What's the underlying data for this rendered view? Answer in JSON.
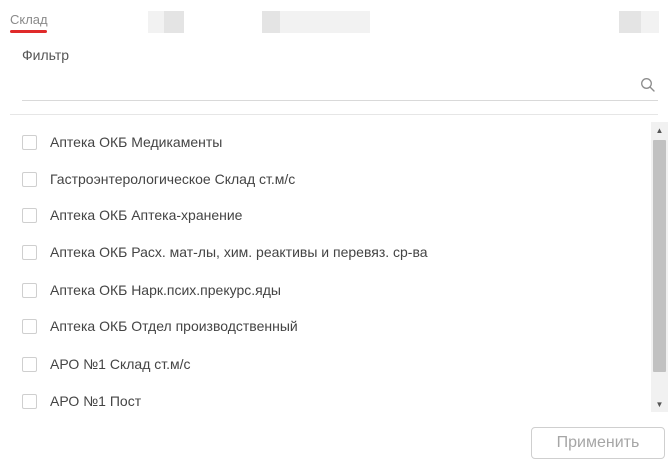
{
  "tabs": {
    "active_label": "Склад",
    "accent_color": "#e02a2a"
  },
  "filter": {
    "label": "Фильтр",
    "value": "",
    "placeholder": "",
    "icon": "search-icon"
  },
  "warehouses": [
    {
      "label": "Аптека ОКБ Медикаменты",
      "checked": false
    },
    {
      "label": "Гастроэнтерологическое Склад ст.м/с",
      "checked": false
    },
    {
      "label": "Аптека ОКБ Аптека-хранение",
      "checked": false
    },
    {
      "label": "Аптека ОКБ Расх. мат-лы, хим. реактивы и перевяз. ср-ва",
      "checked": false
    },
    {
      "label": "Аптека ОКБ Нарк.псих.прекурс.яды",
      "checked": false
    },
    {
      "label": "Аптека ОКБ Отдел производственный",
      "checked": false
    },
    {
      "label": "АРО №1 Склад ст.м/с",
      "checked": false
    },
    {
      "label": "АРО №1 Пост",
      "checked": false
    }
  ],
  "footer": {
    "apply_label": "Применить"
  }
}
